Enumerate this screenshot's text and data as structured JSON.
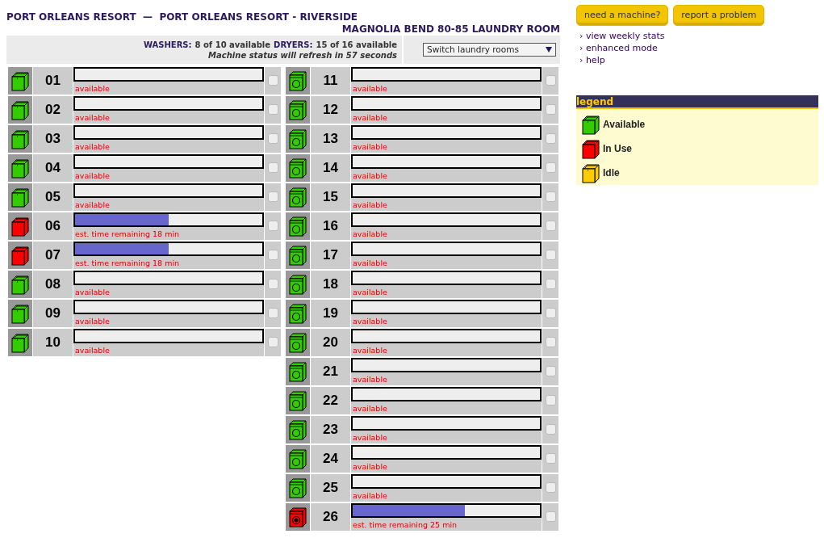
{
  "header": {
    "title": "PORT ORLEANS RESORT  —  PORT ORLEANS RESORT - RIVERSIDE",
    "room": "MAGNOLIA BEND 80-85 LAUNDRY ROOM"
  },
  "summary": {
    "counts": [
      {
        "label": "WASHERS:",
        "value": "8 of 10 available"
      },
      {
        "label": "DRYERS:",
        "value": "15 of 16 available"
      }
    ],
    "refresh_note": "Machine status will refresh in 57 seconds",
    "room_select": "Switch laundry rooms"
  },
  "washers": [
    {
      "number": "01",
      "kind": "available",
      "level": 0,
      "status_text": "available",
      "checked": false
    },
    {
      "number": "02",
      "kind": "available",
      "level": 0,
      "status_text": "available",
      "checked": false
    },
    {
      "number": "03",
      "kind": "available",
      "level": 0,
      "status_text": "available",
      "checked": false
    },
    {
      "number": "04",
      "kind": "available",
      "level": 0,
      "status_text": "available",
      "checked": false
    },
    {
      "number": "05",
      "kind": "available",
      "level": 0,
      "status_text": "available",
      "checked": false
    },
    {
      "number": "06",
      "kind": "in_use",
      "level": 0.5,
      "status_text": "est. time remaining 18 min",
      "checked": false
    },
    {
      "number": "07",
      "kind": "in_use",
      "level": 0.5,
      "status_text": "est. time remaining 18 min",
      "checked": false
    },
    {
      "number": "08",
      "kind": "available",
      "level": 0,
      "status_text": "available",
      "checked": false
    },
    {
      "number": "09",
      "kind": "available",
      "level": 0,
      "status_text": "available",
      "checked": false
    },
    {
      "number": "10",
      "kind": "available",
      "level": 0,
      "status_text": "available",
      "checked": false
    }
  ],
  "dryers": [
    {
      "number": "11",
      "kind": "available",
      "level": 0,
      "status_text": "available",
      "checked": false
    },
    {
      "number": "12",
      "kind": "available",
      "level": 0,
      "status_text": "available",
      "checked": false
    },
    {
      "number": "13",
      "kind": "available",
      "level": 0,
      "status_text": "available",
      "checked": false
    },
    {
      "number": "14",
      "kind": "available",
      "level": 0,
      "status_text": "available",
      "checked": false
    },
    {
      "number": "15",
      "kind": "available",
      "level": 0,
      "status_text": "available",
      "checked": false
    },
    {
      "number": "16",
      "kind": "available",
      "level": 0,
      "status_text": "available",
      "checked": false
    },
    {
      "number": "17",
      "kind": "available",
      "level": 0,
      "status_text": "available",
      "checked": false
    },
    {
      "number": "18",
      "kind": "available",
      "level": 0,
      "status_text": "available",
      "checked": false
    },
    {
      "number": "19",
      "kind": "available",
      "level": 0,
      "status_text": "available",
      "checked": false
    },
    {
      "number": "20",
      "kind": "available",
      "level": 0,
      "status_text": "available",
      "checked": false
    },
    {
      "number": "21",
      "kind": "available",
      "level": 0,
      "status_text": "available",
      "checked": false
    },
    {
      "number": "22",
      "kind": "available",
      "level": 0,
      "status_text": "available",
      "checked": false
    },
    {
      "number": "23",
      "kind": "available",
      "level": 0,
      "status_text": "available",
      "checked": false
    },
    {
      "number": "24",
      "kind": "available",
      "level": 0,
      "status_text": "available",
      "checked": false
    },
    {
      "number": "25",
      "kind": "available",
      "level": 0,
      "status_text": "available",
      "checked": false
    },
    {
      "number": "26",
      "kind": "in_use",
      "level": 0.6,
      "status_text": "est. time remaining 25 min",
      "checked": false
    }
  ],
  "buttons": [
    "need a machine?",
    "report a problem"
  ],
  "links": [
    "› view weekly stats",
    "› enhanced mode",
    "› help"
  ],
  "legend": {
    "title": "legend",
    "items": [
      {
        "label": "Available",
        "kind": "available"
      },
      {
        "label": "In Use",
        "kind": "in_use"
      },
      {
        "label": "Idle",
        "kind": "idle"
      }
    ]
  }
}
